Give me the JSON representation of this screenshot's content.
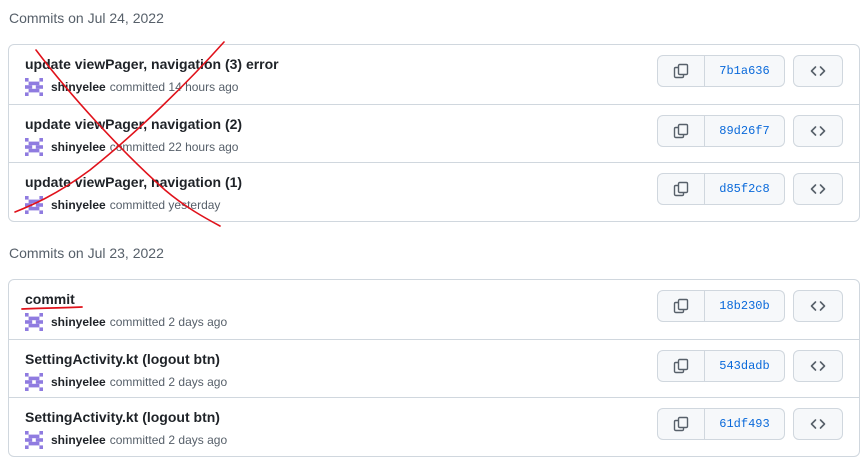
{
  "groups": [
    {
      "heading": "Commits on Jul 24, 2022",
      "commits": [
        {
          "message": "update viewPager, navigation (3) error",
          "author": "shinyelee",
          "action": "committed",
          "time": "14 hours ago",
          "sha": "7b1a636"
        },
        {
          "message": "update viewPager, navigation (2)",
          "author": "shinyelee",
          "action": "committed",
          "time": "22 hours ago",
          "sha": "89d26f7"
        },
        {
          "message": "update viewPager, navigation (1)",
          "author": "shinyelee",
          "action": "committed",
          "time": "yesterday",
          "sha": "d85f2c8"
        }
      ]
    },
    {
      "heading": "Commits on Jul 23, 2022",
      "commits": [
        {
          "message": "commit",
          "author": "shinyelee",
          "action": "committed",
          "time": "2 days ago",
          "sha": "18b230b"
        },
        {
          "message": "SettingActivity.kt (logout btn)",
          "author": "shinyelee",
          "action": "committed",
          "time": "2 days ago",
          "sha": "543dadb"
        },
        {
          "message": "SettingActivity.kt (logout btn)",
          "author": "shinyelee",
          "action": "committed",
          "time": "2 days ago",
          "sha": "61df493"
        }
      ]
    }
  ],
  "icons": {
    "avatar": "identicon-avatar-icon",
    "copy": "copy-icon",
    "browse": "code-icon"
  },
  "colors": {
    "sha_link": "#0969da",
    "border": "#d0d7de",
    "annotation_red": "#e0121b",
    "avatar": "#8f7be0"
  }
}
